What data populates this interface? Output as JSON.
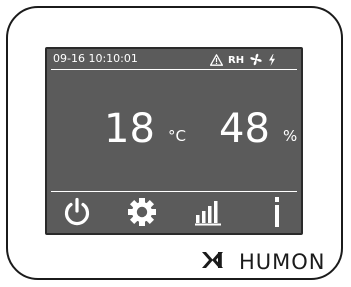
{
  "status": {
    "datetime": "09-16 10:10:01",
    "rh_label": "RH",
    "icons": [
      "warning-icon",
      "fan-icon",
      "power-bolt-icon"
    ]
  },
  "readings": {
    "temperature": "18",
    "temperature_unit": "°C",
    "humidity": "48",
    "humidity_unit": "%"
  },
  "menu": {
    "items": [
      "power-icon",
      "settings-gear-icon",
      "statistics-bars-icon",
      "info-icon"
    ]
  },
  "brand": {
    "logo_text": "HUMON"
  },
  "colors": {
    "screen_bg": "#5b5b5b",
    "foreground": "#ffffff",
    "bezel": "#1b1b1b"
  }
}
